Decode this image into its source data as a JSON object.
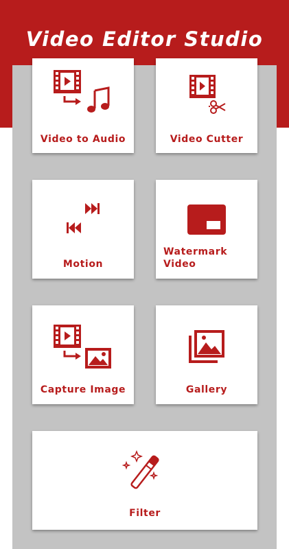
{
  "app": {
    "title": "Video Editor Studio"
  },
  "colors": {
    "primary": "#b71c1c",
    "panel": "#c3c3c3",
    "card": "#ffffff"
  },
  "menu": [
    {
      "id": "video-to-audio",
      "label": "Video to Audio",
      "icon": "video-to-audio-icon"
    },
    {
      "id": "video-cutter",
      "label": "Video Cutter",
      "icon": "video-cutter-icon"
    },
    {
      "id": "motion",
      "label": "Motion",
      "icon": "motion-icon"
    },
    {
      "id": "watermark-video",
      "label_line1": "Watermark",
      "label_line2": "Video",
      "icon": "watermark-icon"
    },
    {
      "id": "capture-image",
      "label": "Capture Image",
      "icon": "capture-image-icon"
    },
    {
      "id": "gallery",
      "label": "Gallery",
      "icon": "gallery-icon"
    },
    {
      "id": "filter",
      "label": "Filter",
      "icon": "magic-wand-icon"
    }
  ]
}
